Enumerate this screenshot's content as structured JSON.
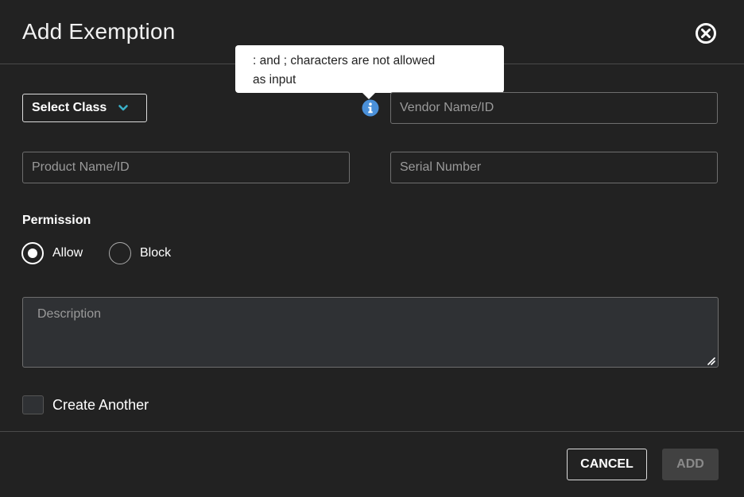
{
  "dialog": {
    "title": "Add Exemption"
  },
  "tooltip": {
    "line1": ": and ; characters are not allowed",
    "line2": "as input"
  },
  "form": {
    "select_class_label": "Select Class",
    "vendor_placeholder": "Vendor Name/ID",
    "vendor_value": "",
    "product_placeholder": "Product Name/ID",
    "product_value": "",
    "serial_placeholder": "Serial Number",
    "serial_value": "",
    "permission_label": "Permission",
    "permission_options": {
      "allow": "Allow",
      "block": "Block"
    },
    "permission_selected": "Allow",
    "description_placeholder": "Description",
    "create_another_label": "Create Another",
    "create_another_checked": false
  },
  "footer": {
    "cancel_label": "CANCEL",
    "add_label": "ADD"
  },
  "icons": {
    "close": "close-circle-icon",
    "chevron": "chevron-down-icon",
    "info": "info-icon"
  },
  "colors": {
    "background": "#222222",
    "info_icon": "#4a90d9",
    "chevron": "#3ab0c8",
    "add_disabled": "#414141"
  }
}
